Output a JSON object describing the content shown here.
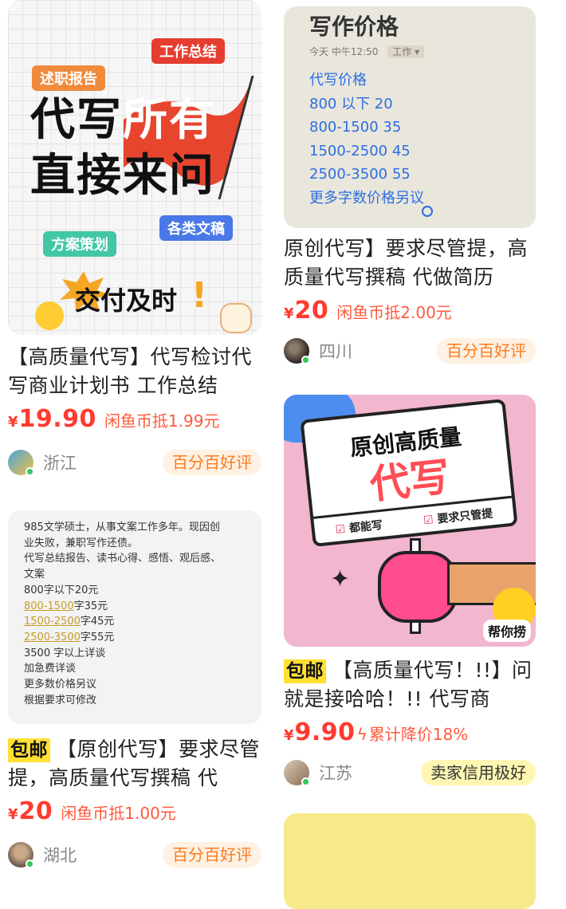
{
  "colors": {
    "price_red": "#ff3b30",
    "badge_orange": "#ff7a1a",
    "badge_bg": "#fff1e3",
    "free_shipping_yellow": "#ffe033",
    "online_dot": "#34c759"
  },
  "left_column": [
    {
      "image": {
        "stickers": [
          "述职报告",
          "工作总结",
          "方案策划",
          "各类文稿"
        ],
        "headline_line1_a": "代写",
        "headline_line1_b": "所有",
        "headline_line2": "直接来问",
        "footer_text": "交付及时"
      },
      "title": "【高质量代写】代写检讨代写商业计划书 工作总结",
      "price_symbol": "¥",
      "price": "19.90",
      "price_note": "闲鱼币抵1.99元",
      "region": "浙江",
      "badge": "百分百好评",
      "avatar_icon": "book-avatar-icon"
    },
    {
      "image": {
        "lines": [
          "985文学硕士，从事文案工作多年。现因创",
          "业失败，兼职写作还债。",
          "代写总结报告、读书心得、感悟、观后感、",
          "文案",
          "800字以下20元"
        ],
        "underlined_rows": [
          {
            "range": "800-1500",
            "price": "字35元"
          },
          {
            "range": "1500-2500",
            "price": "字45元"
          },
          {
            "range": "2500-3500",
            "price": "字55元"
          }
        ],
        "tail_lines": [
          "3500 字以上详谈",
          "加急费详谈",
          "更多数价格另议",
          "根据要求可修改"
        ]
      },
      "free_shipping_tag": "包邮",
      "title": "【原创代写】要求尽管提，高质量代写撰稿 代",
      "price_symbol": "¥",
      "price": "20",
      "price_note": "闲鱼币抵1.00元",
      "region": "湖北",
      "badge": "百分百好评",
      "avatar_icon": "person-avatar-icon"
    }
  ],
  "right_column": [
    {
      "image": {
        "heading": "写作价格",
        "meta_time": "今天 中午12:50",
        "meta_tag": "工作",
        "list": [
          "代写价格",
          "800 以下 20",
          "800-1500  35",
          "1500-2500 45",
          "2500-3500  55",
          "更多字数价格另议"
        ]
      },
      "title": "原创代写】要求尽管提，高质量代写撰稿 代做简历",
      "price_symbol": "¥",
      "price": "20",
      "price_note": "闲鱼币抵2.00元",
      "region": "四川",
      "badge": "百分百好评",
      "avatar_icon": "dark-avatar-icon"
    },
    {
      "image": {
        "sign_line1": "原创高质量",
        "sign_line2": "代写",
        "check1": "都能写",
        "check2": "要求只管提",
        "helper_label": "帮你捞"
      },
      "free_shipping_tag": "包邮",
      "title": "【高质量代写！!!】问就是接哈哈！!! 代写商",
      "price_symbol": "¥",
      "price": "9.90",
      "price_note": "累计降价18%",
      "region": "江苏",
      "badge": "卖家信用极好",
      "avatar_icon": "landscape-avatar-icon"
    }
  ]
}
